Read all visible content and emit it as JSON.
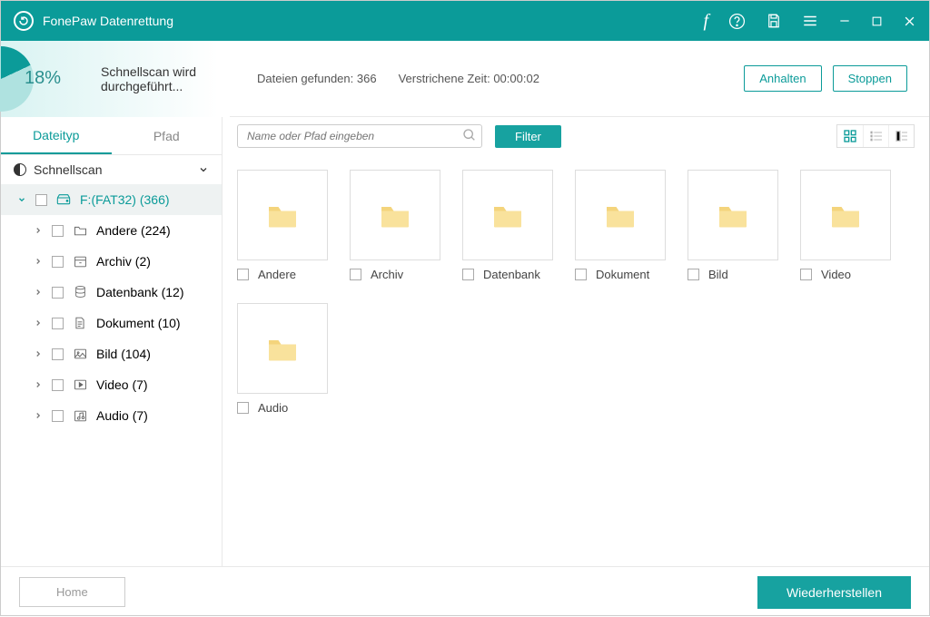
{
  "titlebar": {
    "app_title": "FonePaw Datenrettung"
  },
  "status": {
    "percent": "18%",
    "scan_text": "Schnellscan wird durchgeführt...",
    "files_found": "Dateien gefunden: 366",
    "elapsed": "Verstrichene Zeit: 00:00:02",
    "pause": "Anhalten",
    "stop": "Stoppen"
  },
  "sidebar": {
    "tab_filetype": "Dateityp",
    "tab_path": "Pfad",
    "quickscan": "Schnellscan",
    "drive": "F:(FAT32) (366)",
    "items": [
      {
        "label": "Andere (224)"
      },
      {
        "label": "Archiv (2)"
      },
      {
        "label": "Datenbank (12)"
      },
      {
        "label": "Dokument (10)"
      },
      {
        "label": "Bild (104)"
      },
      {
        "label": "Video (7)"
      },
      {
        "label": "Audio (7)"
      }
    ]
  },
  "toolbar": {
    "search_placeholder": "Name oder Pfad eingeben",
    "filter": "Filter"
  },
  "grid": {
    "folders": [
      {
        "label": "Andere"
      },
      {
        "label": "Archiv"
      },
      {
        "label": "Datenbank"
      },
      {
        "label": "Dokument"
      },
      {
        "label": "Bild"
      },
      {
        "label": "Video"
      },
      {
        "label": "Audio"
      }
    ]
  },
  "footer": {
    "home": "Home",
    "recover": "Wiederherstellen"
  }
}
